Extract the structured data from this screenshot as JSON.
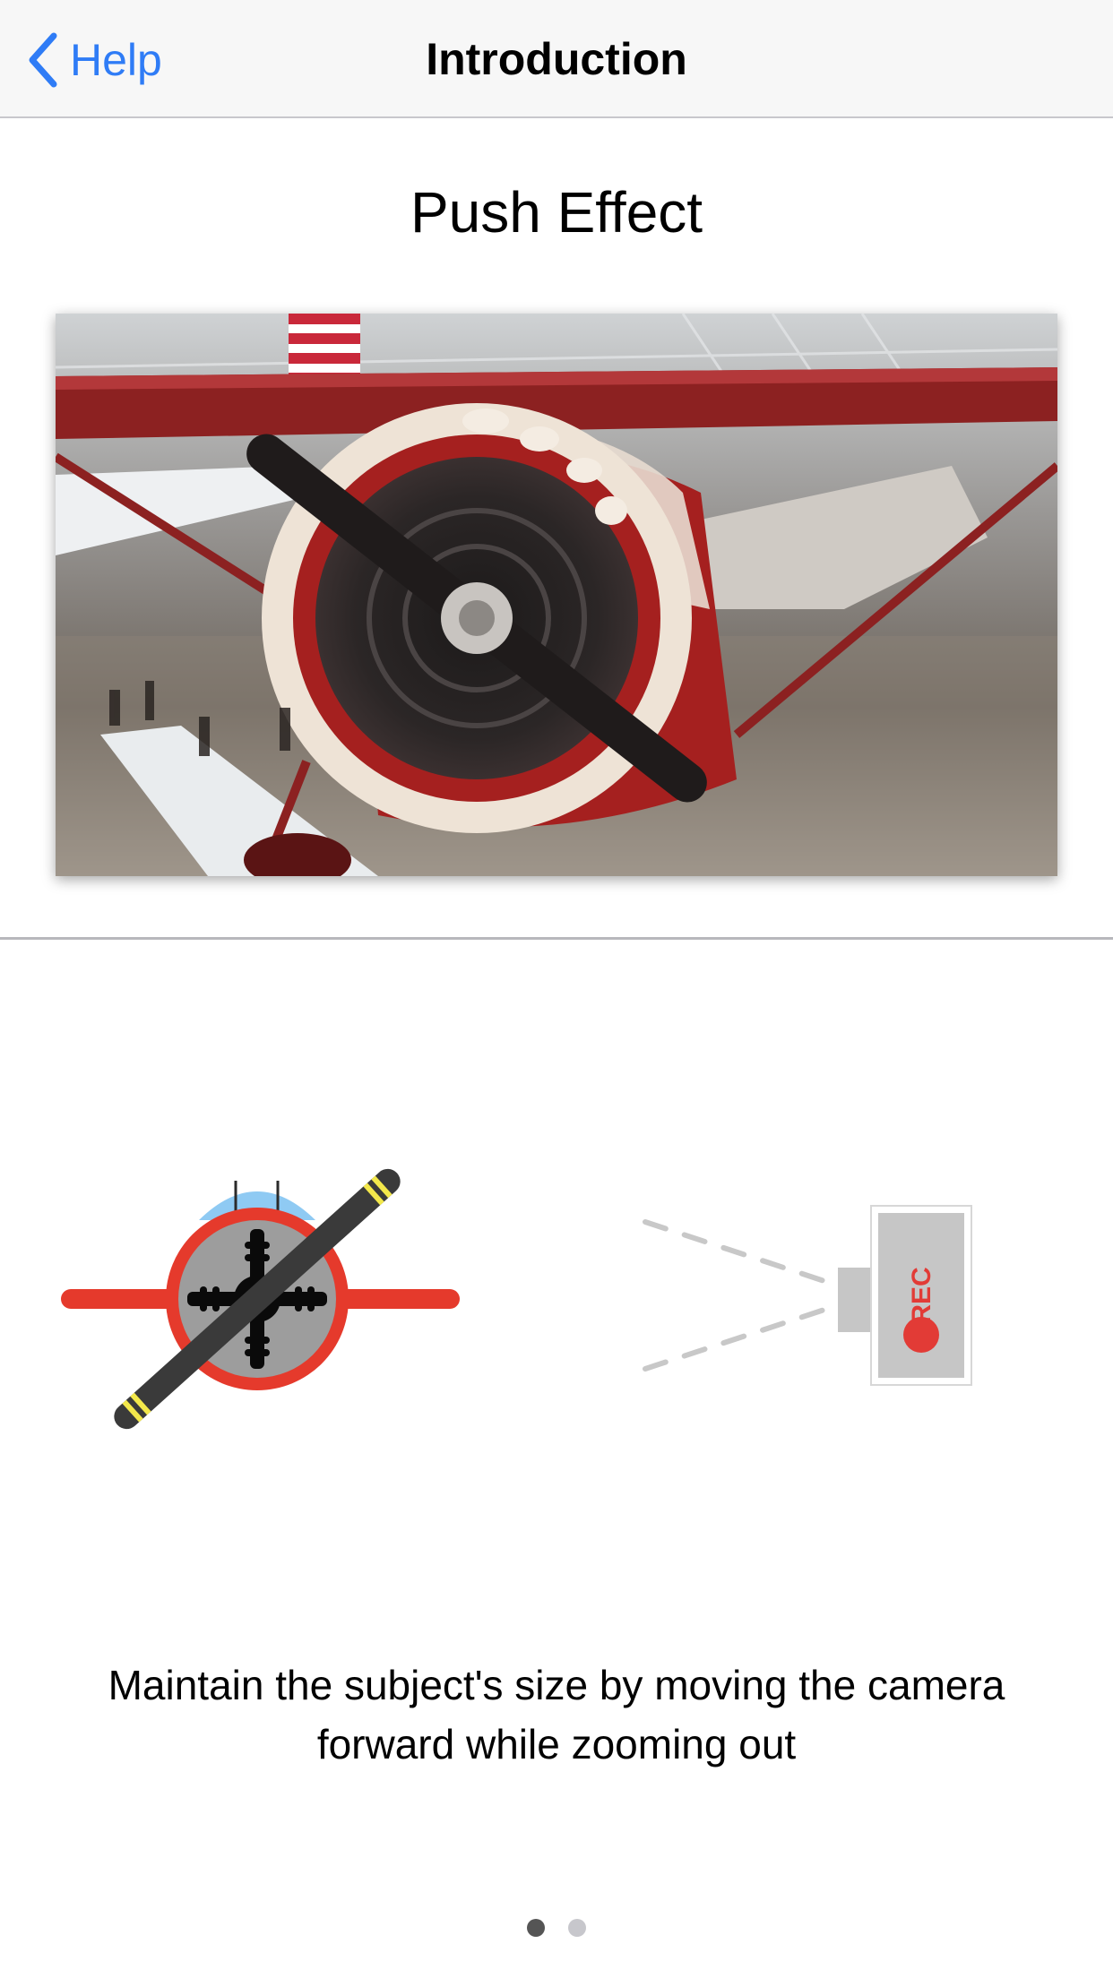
{
  "navbar": {
    "back_label": "Help",
    "title": "Introduction"
  },
  "content": {
    "section_title": "Push Effect",
    "photo_alt": "Red and white vintage airplane in a hangar",
    "caption": "Maintain the subject's size by moving the camera forward while zooming out",
    "camera_rec_label": "REC"
  },
  "pager": {
    "total_pages": 2,
    "current_page": 1
  },
  "colors": {
    "accent": "#2f7cf6",
    "plane_red": "#e53a2c",
    "rec_red": "#e23b36"
  }
}
